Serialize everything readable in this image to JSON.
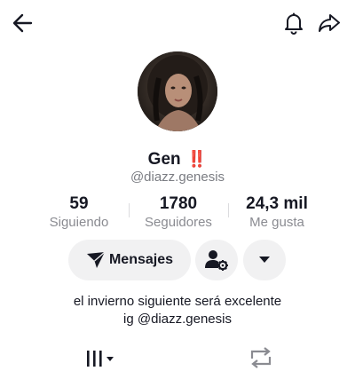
{
  "profile": {
    "name": "Gen",
    "name_emoji": "‼️",
    "handle": "@diazz.genesis",
    "bio_line1": "el invierno siguiente será excelente",
    "bio_line2": "ig @diazz.genesis"
  },
  "stats": {
    "following": {
      "value": "59",
      "label": "Siguiendo"
    },
    "followers": {
      "value": "1780",
      "label": "Seguidores"
    },
    "likes": {
      "value": "24,3 mil",
      "label": "Me gusta"
    }
  },
  "actions": {
    "message_label": "Mensajes"
  },
  "icons": {
    "back": "arrow-left-icon",
    "notifications": "bell-icon",
    "share": "share-arrow-icon",
    "message": "paper-plane-icon",
    "add_friend": "person-gear-icon",
    "dropdown": "caret-down-icon",
    "videos_tab": "grid-bars-icon",
    "reposts_tab": "repost-icon"
  },
  "colors": {
    "text": "#161823",
    "secondary": "#8a8b91",
    "button_bg": "#f1f1f2",
    "emoji_red": "#d62828"
  }
}
